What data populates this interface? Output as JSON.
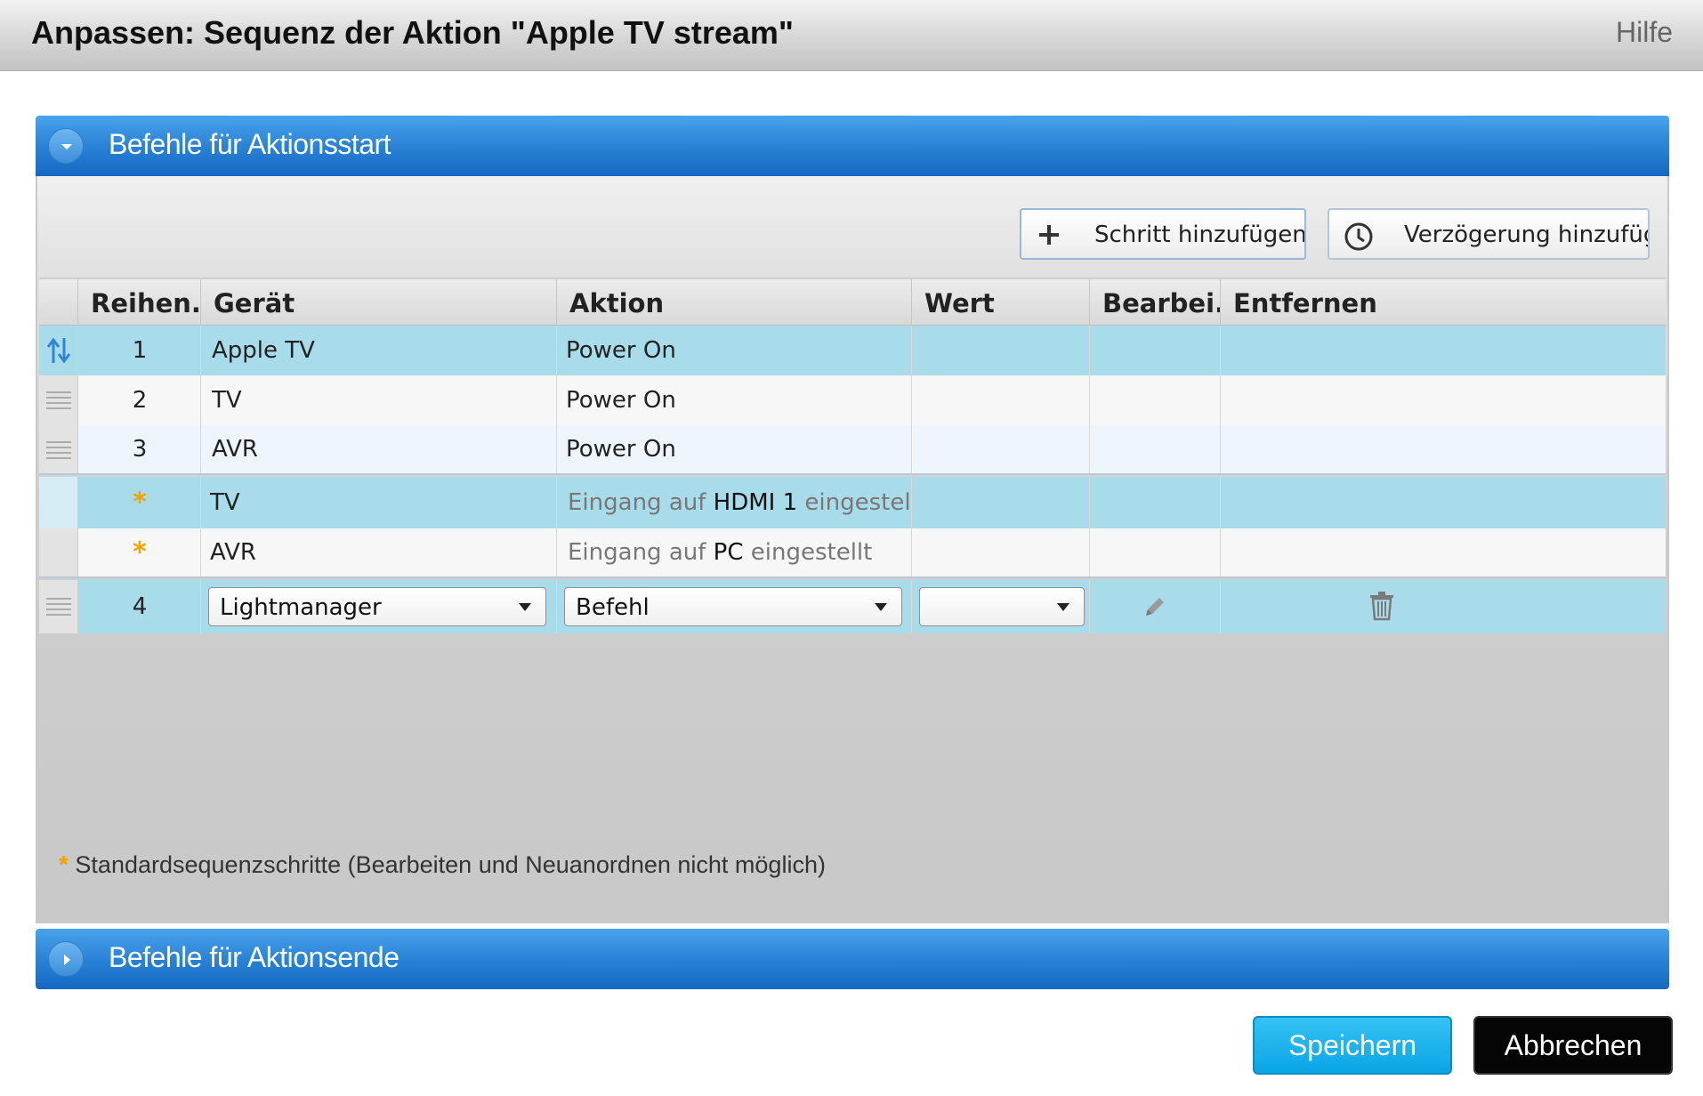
{
  "window": {
    "title": "Anpassen: Sequenz der Aktion \"Apple TV stream\"",
    "help_label": "Hilfe"
  },
  "section_start": {
    "label": "Befehle für Aktionsstart"
  },
  "section_end": {
    "label": "Befehle für Aktionsende"
  },
  "toolbar": {
    "add_step_label": "Schritt hinzufügen",
    "add_delay_label": "Verzögerung hinzufüg"
  },
  "table": {
    "columns": [
      "Reihen...",
      "Gerät",
      "Aktion",
      "Wert",
      "Bearbei...",
      "Entfernen"
    ],
    "rows": [
      {
        "order": "1",
        "device": "Apple TV",
        "action": "Power On"
      },
      {
        "order": "2",
        "device": "TV",
        "action": "Power On"
      },
      {
        "order": "3",
        "device": "AVR",
        "action": "Power On"
      }
    ],
    "default_rows": [
      {
        "marker": "*",
        "device": "TV",
        "action_prefix": "Eingang auf ",
        "action_value": "HDMI 1",
        "action_suffix": " eingestellt"
      },
      {
        "marker": "*",
        "device": "AVR",
        "action_prefix": "Eingang auf ",
        "action_value": "PC",
        "action_suffix": " eingestellt"
      }
    ],
    "edit_row": {
      "order": "4",
      "device_selected": "Lightmanager",
      "action_selected": "Befehl",
      "value_selected": ""
    }
  },
  "footnote": {
    "marker": "*",
    "text": "Standardsequenzschritte (Bearbeiten und Neuanordnen nicht möglich)"
  },
  "buttons": {
    "save": "Speichern",
    "cancel": "Abbrechen"
  },
  "colors": {
    "accent_blue": "#2a83d6",
    "row_highlight": "#a8dcea",
    "default_star": "#f5a300",
    "save_button": "#0aa5e6",
    "cancel_button": "#050505"
  }
}
